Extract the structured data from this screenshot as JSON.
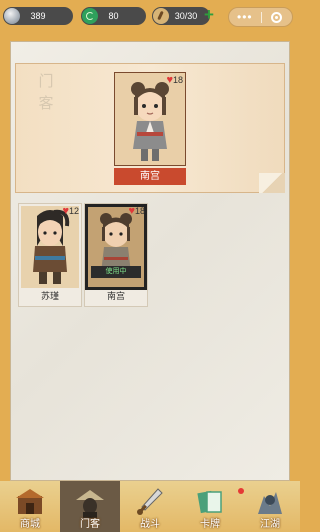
{
  "status": {
    "silver": "389",
    "jade": "80",
    "stamina": "30/30",
    "plus_icon": "plus-icon"
  },
  "panel": {
    "section_title": "门客",
    "featured": {
      "name": "南宫",
      "hp": "18"
    },
    "roster": [
      {
        "name": "苏瑾",
        "hp": "12",
        "in_use": false
      },
      {
        "name": "南宫",
        "hp": "18",
        "in_use": true,
        "badge": "使用中"
      }
    ]
  },
  "nav": [
    {
      "label": "商城",
      "icon": "shop-icon"
    },
    {
      "label": "门客",
      "icon": "retainer-icon",
      "selected": true
    },
    {
      "label": "战斗",
      "icon": "sword-icon"
    },
    {
      "label": "卡牌",
      "icon": "cards-icon",
      "badge_dot": true
    },
    {
      "label": "江湖",
      "icon": "jianghu-icon"
    }
  ],
  "colors": {
    "background": "#e3ad52",
    "banner_red": "#c94a2e",
    "heart_red": "#e0393a"
  }
}
